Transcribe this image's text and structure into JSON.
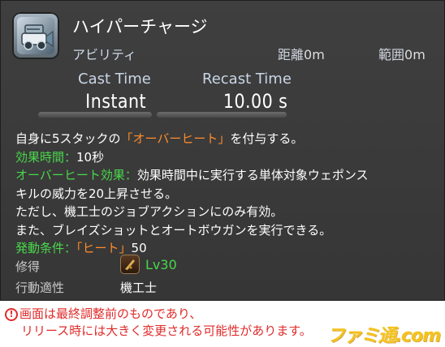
{
  "action": {
    "name": "ハイパーチャージ",
    "type": "アビリティ",
    "distance_label": "距離",
    "distance_value": "0m",
    "radius_label": "範囲",
    "radius_value": "0m",
    "cast_time_label": "Cast Time",
    "cast_time_value": "Instant",
    "recast_time_label": "Recast Time",
    "recast_time_value": "10.00 s"
  },
  "description": {
    "line1_a": "自身に5スタックの",
    "line1_b": "「オーバーヒート」",
    "line1_c": "を付与する。",
    "line2_label": "効果時間：",
    "line2_value": "10秒",
    "line3_label": "オーバーヒート効果：",
    "line3_value": "効果時間中に実行する単体対象ウェポンス",
    "line4": "キルの威力を20上昇させる。",
    "line5": "ただし、機工士のジョブアクションにのみ有効。",
    "line6": "また、ブレイズショットとオートボウガンを実行できる。",
    "line7_label": "発動条件：",
    "line7_value_a": "「ヒート」",
    "line7_value_b": "50"
  },
  "meta": {
    "acquired_label": "修得",
    "acquired_level": "Lv30",
    "job_label": "行動適性",
    "job_value": "機工士"
  },
  "notice": {
    "icon": "exclamation-circle-icon",
    "line1": "画面は最終調整前のものであり、",
    "line2": "リリース時には大きく変更される可能性があります。"
  },
  "watermark": {
    "text": "ファミ通.com"
  },
  "colors": {
    "panel_bg": "#3b3b3b",
    "highlight_green": "#49d84b",
    "highlight_orange": "#ff8c2a",
    "notice_red": "#e12a2a",
    "watermark_yellow": "#f4c21a"
  }
}
